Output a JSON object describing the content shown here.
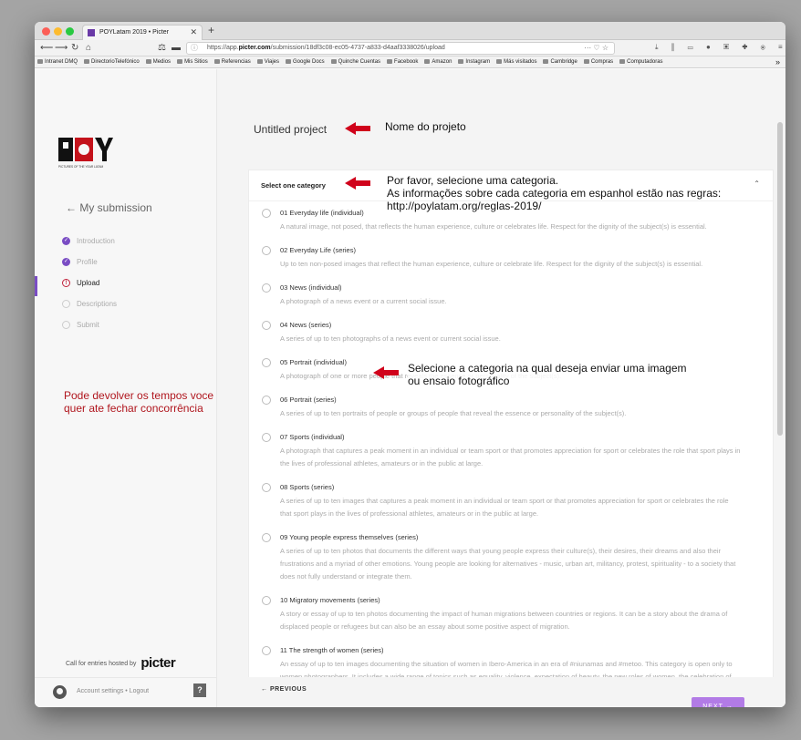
{
  "browser": {
    "tab_title": "POYLatam 2019 • Picter",
    "url_prefix": "https://app.",
    "url_host": "picter.com",
    "url_path": "/submission/18df3c08-ec05-4737-a833-d4aaf3338026/upload",
    "url_right_icons": "··· ♡ ☆",
    "toolbar_icons": "⤓ ⫼ ▭ ● ▣ ✚ ⦿ ≡",
    "bookmarks": [
      "Intranet DMQ",
      "DirectorioTelefónico",
      "Medios",
      "Mis Sitios",
      "Referencias",
      "Viajes",
      "Google Docs",
      "Quinche Cuentas",
      "Facebook",
      "Amazon",
      "Instagram",
      "Más visitados",
      "Cambridge",
      "Compras",
      "Computadoras"
    ]
  },
  "sidebar": {
    "logo_letters": "POY",
    "logo_sub": "PICTURES OF THE YEAR LATAM",
    "back_label": "← My submission",
    "steps": [
      {
        "label": "Introduction",
        "state": "done"
      },
      {
        "label": "Profile",
        "state": "done"
      },
      {
        "label": "Upload",
        "state": "current"
      },
      {
        "label": "Descriptions",
        "state": "todo"
      },
      {
        "label": "Submit",
        "state": "todo"
      }
    ],
    "note": "Pode devolver os tempos voce quer ate fechar concorrência",
    "hosted_prefix": "Call for entries hosted by",
    "hosted_brand": "picter",
    "account_link": "Account settings • Logout",
    "help_label": "?"
  },
  "main": {
    "project_title": "Untitled project",
    "select_label": "Select one category",
    "annotations": {
      "project": "Nome do projeto",
      "category_1": "Por favor, selecione uma categoria.",
      "category_2": "As informações sobre cada categoria em espanhol estão nas regras:",
      "category_3": "http://poylatam.org/reglas-2019/",
      "choose_1": "Selecione a categoria na qual deseja enviar uma imagem",
      "choose_2": "ou ensaio fotográfico"
    },
    "categories": [
      {
        "title": "01 Everyday life (individual)",
        "desc": "A natural image, not posed, that reflects the human experience, culture or celebrates life. Respect for the dignity of the subject(s) is essential."
      },
      {
        "title": "02 Everyday Life (series)",
        "desc": "Up to ten non-posed images that reflect the human experience, culture or celebrate life. Respect for the dignity of the subject(s) is essential."
      },
      {
        "title": "03 News (individual)",
        "desc": "A photograph of a news event or a current social issue."
      },
      {
        "title": "04 News (series)",
        "desc": "A series of up to ten photographs of a news event or current social issue."
      },
      {
        "title": "05 Portrait (individual)",
        "desc": "A photograph of one or more people that reveals the essence or personality of the subject(s)."
      },
      {
        "title": "06 Portrait (series)",
        "desc": "A series of up to ten portraits of people or groups of people that reveal the essence or personality of the subject(s)."
      },
      {
        "title": "07 Sports (individual)",
        "desc": "A photograph that captures a peak moment in an individual or team sport or that promotes appreciation for sport or celebrates the role that sport plays in the lives of professional athletes, amateurs or in the public at large."
      },
      {
        "title": "08 Sports (series)",
        "desc": "A series of up to ten images that captures a peak moment in an individual or team sport or that promotes appreciation for sport or celebrates the role that sport plays in the lives of professional athletes, amateurs or in the public at large."
      },
      {
        "title": "09 Young people express themselves (series)",
        "desc": "A series of up to ten photos that documents the different ways that young people express their culture(s), their desires, their dreams and also their frustrations and a myriad of other emotions. Young people are looking for alternatives - music, urban art, militancy, protest, spirituality - to a society that does not fully understand or integrate them."
      },
      {
        "title": "10 Migratory movements (series)",
        "desc": "A story or essay of up to ten photos documenting the impact of human migrations between countries or regions. It can be a story about the drama of displaced people or refugees but can also be an essay about some positive aspect of migration."
      },
      {
        "title": "11 The strength of women (series)",
        "desc": "An essay of up to ten images documenting the situation of women in Ibero-America in an era of #niunamas and #metoo. This category is open only to women photographers. It includes a wide range of topics such as equality, violence, expectation of beauty, the new roles of women, the celebration of the feminine, politics, spirituality, feminism, leadership and others."
      }
    ],
    "prev_label": "← PREVIOUS",
    "next_label": "NEXT →"
  },
  "colors": {
    "accent": "#7a4dc4",
    "next_button": "#b27be6",
    "annotation_arrow": "#d0021b",
    "sidebar_note": "#b0161e"
  }
}
